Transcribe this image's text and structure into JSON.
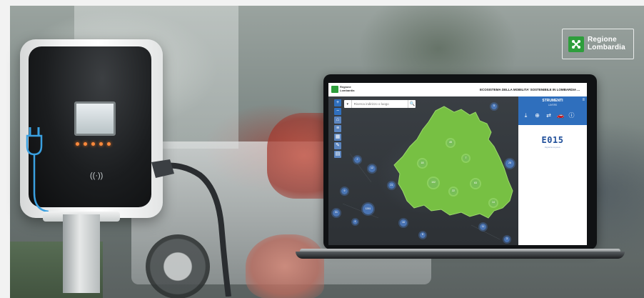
{
  "logo": {
    "line1": "Regione",
    "line2": "Lombardia"
  },
  "app": {
    "header": {
      "brand_line1": "Regione",
      "brand_line2": "Lombardia",
      "title": "ECOSISTEMA DELLA MOBILITA' SOSTENIBILE IN LOMBARDIA ..."
    },
    "search": {
      "placeholder": "Ricerca indirizzo o luogo",
      "dropdown_glyph": "▾",
      "button_glyph": "🔍"
    },
    "map_tools": [
      {
        "icon": "zoom-in-icon",
        "glyph": "+"
      },
      {
        "icon": "zoom-out-icon",
        "glyph": "−"
      },
      {
        "icon": "home-icon",
        "glyph": "⌂"
      },
      {
        "icon": "layers-icon",
        "glyph": "≡"
      },
      {
        "icon": "grid-icon",
        "glyph": "▦"
      },
      {
        "icon": "measure-icon",
        "glyph": "✎"
      },
      {
        "icon": "print-icon",
        "glyph": "▤"
      }
    ],
    "panel": {
      "title": "STRUMENTI",
      "subtitle": "LAYERS",
      "menu_glyph": "≡",
      "tools": [
        {
          "icon": "download-icon",
          "glyph": "⤓"
        },
        {
          "icon": "locate-icon",
          "glyph": "⊕"
        },
        {
          "icon": "swap-icon",
          "glyph": "⇄"
        },
        {
          "icon": "car-icon",
          "glyph": "🚗"
        },
        {
          "icon": "info-icon",
          "glyph": "ⓘ"
        }
      ],
      "brand": "E015",
      "brand_sub": "Digital Ecosystem"
    },
    "clusters": [
      {
        "value": "2",
        "region": false
      },
      {
        "value": "12",
        "region": false
      },
      {
        "value": "18",
        "region": true
      },
      {
        "value": "45",
        "region": true
      },
      {
        "value": "102",
        "region": true
      },
      {
        "value": "7",
        "region": true
      },
      {
        "value": "63",
        "region": true
      },
      {
        "value": "22",
        "region": true
      },
      {
        "value": "14",
        "region": true
      },
      {
        "value": "9",
        "region": false
      },
      {
        "value": "1261",
        "region": false
      },
      {
        "value": "31",
        "region": false
      },
      {
        "value": "4",
        "region": false
      },
      {
        "value": "16",
        "region": false
      },
      {
        "value": "28",
        "region": false
      },
      {
        "value": "5",
        "region": false
      },
      {
        "value": "11",
        "region": false
      },
      {
        "value": "3",
        "region": false
      },
      {
        "value": "8",
        "region": false
      },
      {
        "value": "21",
        "region": false
      }
    ]
  },
  "colors": {
    "brand_green": "#2e9e3c",
    "region_green": "#77c043",
    "cluster_blue": "#4f80c9",
    "panel_blue": "#2f6fbd"
  }
}
